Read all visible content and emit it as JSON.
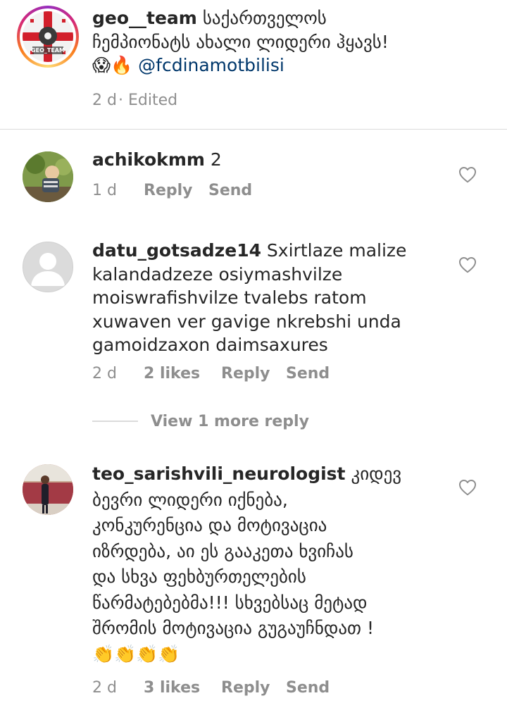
{
  "caption": {
    "username": "geo__team",
    "avatar_label": "GEO_TEAM",
    "lines": [
      "საქართველოს",
      "ჩემპიონატს ახალი ლიდერი ჰყავს!"
    ],
    "emojis": "😱🔥",
    "mention": "@fcdinamotbilisi",
    "time": "2 d",
    "edited": "· Edited"
  },
  "comments": [
    {
      "username": "achikokmm",
      "lines": [
        " 2"
      ],
      "time": "1 d",
      "reply": "Reply",
      "send": "Send"
    },
    {
      "username": "datu_gotsadze14",
      "lines": [
        " Sxirtlaze malize",
        "kalandadzeze osiymashvilze",
        "moiswrafishvilze tvalebs ratom",
        "xuwaven ver gavige nkrebshi unda",
        "gamoidzaxon daimsaxures"
      ],
      "time": "2 d",
      "likes": "2 likes",
      "reply": "Reply",
      "send": "Send",
      "view_replies": "View 1 more reply"
    },
    {
      "username": "teo_sarishvili_neurologist",
      "lines": [
        " კიდევ",
        "ბევრი ლიდერი იქნება,",
        "კონკურენცია და მოტივაცია",
        "იზრდება, აი ეს გააკეთა ხვიჩას",
        "და სხვა ფეხბურთელების",
        "წარმატებებმა!!! სხვებსაც მეტად",
        "შრომის მოტივაცია გუგაუჩნდათ !"
      ],
      "emojis": "👏👏👏👏",
      "time": "2 d",
      "likes": "3 likes",
      "reply": "Reply",
      "send": "Send"
    }
  ],
  "colors": {
    "text": "#262626",
    "secondary": "#8e8e8e",
    "mention": "#00376b",
    "story_ring_start": "#feda75",
    "story_ring_mid": "#d62976",
    "story_ring_end": "#962fbf"
  },
  "icons": [
    "heart-outline-icon",
    "default-avatar-icon"
  ]
}
